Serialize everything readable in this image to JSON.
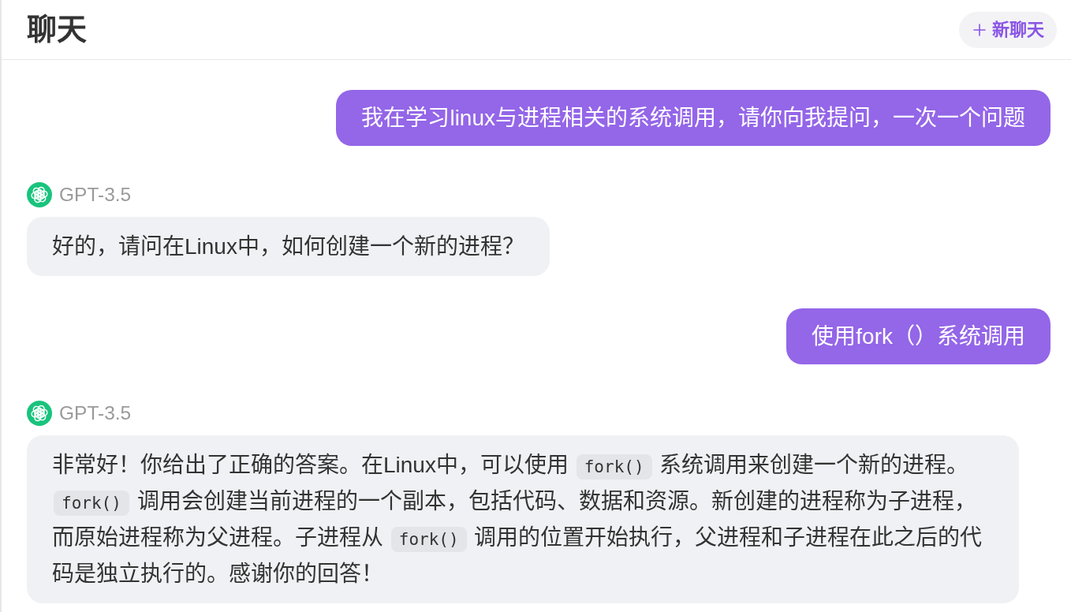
{
  "header": {
    "title": "聊天",
    "new_chat_button": {
      "label": "新聊天"
    }
  },
  "messages": [
    {
      "kind": "user",
      "text": "我在学习linux与进程相关的系统调用，请你向我提问，一次一个问题"
    },
    {
      "kind": "assistant",
      "model": "GPT-3.5",
      "segments": [
        {
          "kind": "text",
          "text": "好的，请问在Linux中，如何创建一个新的进程？"
        }
      ]
    },
    {
      "kind": "user",
      "text": "使用fork（）系统调用"
    },
    {
      "kind": "assistant",
      "model": "GPT-3.5",
      "segments": [
        {
          "kind": "text",
          "text": "非常好！你给出了正确的答案。在Linux中，可以使用 "
        },
        {
          "kind": "code",
          "text": "fork()"
        },
        {
          "kind": "text",
          "text": " 系统调用来创建一个新的进程。 "
        },
        {
          "kind": "code",
          "text": "fork()"
        },
        {
          "kind": "text",
          "text": " 调用会创建当前进程的一个副本，包括代码、数据和资源。新创建的进程称为子进程，而原始进程称为父进程。子进程从 "
        },
        {
          "kind": "code",
          "text": "fork()"
        },
        {
          "kind": "text",
          "text": " 调用的位置开始执行，父进程和子进程在此之后的代码是独立执行的。感谢你的回答！"
        }
      ]
    }
  ]
}
